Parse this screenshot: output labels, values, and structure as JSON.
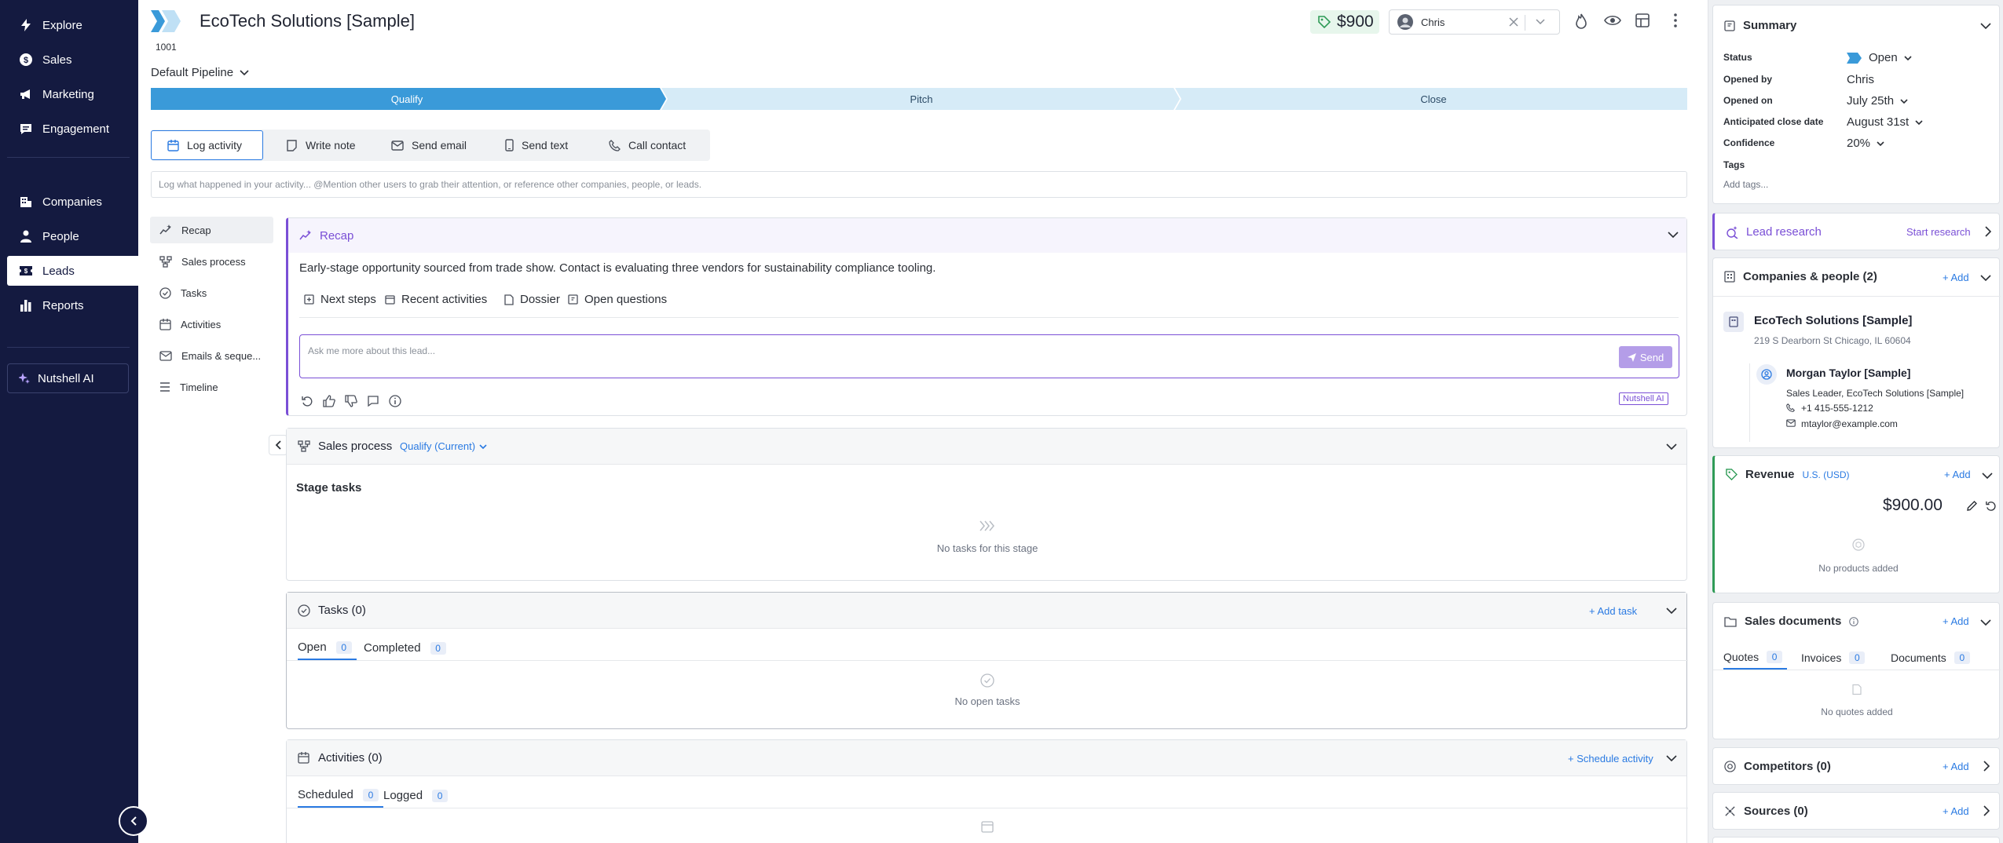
{
  "nav": {
    "items": [
      {
        "label": "Explore",
        "icon": "bolt-icon"
      },
      {
        "label": "Sales",
        "icon": "dollar-icon"
      },
      {
        "label": "Marketing",
        "icon": "megaphone-icon"
      },
      {
        "label": "Engagement",
        "icon": "chat-icon"
      },
      {
        "label": "Companies",
        "icon": "building-icon"
      },
      {
        "label": "People",
        "icon": "person-icon"
      },
      {
        "label": "Leads",
        "icon": "ticket-icon"
      },
      {
        "label": "Reports",
        "icon": "bar-chart-icon"
      }
    ],
    "ai_label": "Nutshell AI"
  },
  "header": {
    "title": "EcoTech Solutions [Sample]",
    "lead_id": "1001",
    "value": "$900",
    "assignee": "Chris",
    "pipeline": "Default Pipeline"
  },
  "stages": [
    "Qualify",
    "Pitch",
    "Close"
  ],
  "actions": [
    "Log activity",
    "Write note",
    "Send email",
    "Send text",
    "Call contact"
  ],
  "log_placeholder": "Log what happened in your activity... @Mention other users to grab their attention, or reference other companies, people, or leads.",
  "sidebar_links": [
    "Recap",
    "Sales process",
    "Tasks",
    "Activities",
    "Emails & seque...",
    "Timeline"
  ],
  "recap": {
    "title": "Recap",
    "text": "Early-stage opportunity sourced from trade show. Contact is evaluating three vendors for sustainability compliance tooling.",
    "chips": [
      "Next steps",
      "Recent activities",
      "Dossier",
      "Open questions"
    ],
    "ask_placeholder": "Ask me more about this lead...",
    "send_label": "Send",
    "badge": "Nutshell AI"
  },
  "sales_process": {
    "title": "Sales process",
    "stage": "Qualify (Current)",
    "stage_tasks": "Stage tasks",
    "empty": "No tasks for this stage"
  },
  "tasks": {
    "title": "Tasks (0)",
    "add": "+ Add task",
    "tabs": [
      {
        "label": "Open",
        "count": "0"
      },
      {
        "label": "Completed",
        "count": "0"
      }
    ],
    "empty": "No open tasks"
  },
  "activities": {
    "title": "Activities (0)",
    "add": "+ Schedule activity",
    "tabs": [
      {
        "label": "Scheduled",
        "count": "0"
      },
      {
        "label": "Logged",
        "count": "0"
      }
    ]
  },
  "summary": {
    "title": "Summary",
    "fields": [
      {
        "label": "Status",
        "value": "Open"
      },
      {
        "label": "Opened by",
        "value": "Chris"
      },
      {
        "label": "Opened on",
        "value": "July 25th"
      },
      {
        "label": "Anticipated close date",
        "value": "August 31st"
      },
      {
        "label": "Confidence",
        "value": "20%"
      }
    ],
    "tags_label": "Tags",
    "tags_placeholder": "Add tags..."
  },
  "lead_research": {
    "title": "Lead research",
    "action": "Start research"
  },
  "companies_people": {
    "title": "Companies & people (2)",
    "add": "+ Add",
    "company": {
      "name": "EcoTech Solutions [Sample]",
      "address": "219 S Dearborn St Chicago, IL 60604"
    },
    "person": {
      "name": "Morgan Taylor [Sample]",
      "role": "Sales Leader, EcoTech Solutions [Sample]",
      "phone": "+1 415-555-1212",
      "email": "mtaylor@example.com"
    }
  },
  "revenue": {
    "title": "Revenue",
    "currency": "U.S. (USD)",
    "add": "+ Add",
    "amount": "$900.00",
    "empty": "No products added"
  },
  "sales_documents": {
    "title": "Sales documents",
    "add": "+ Add",
    "tabs": [
      {
        "label": "Quotes",
        "count": "0"
      },
      {
        "label": "Invoices",
        "count": "0"
      },
      {
        "label": "Documents",
        "count": "0"
      }
    ],
    "empty": "No quotes added"
  },
  "competitors": {
    "title": "Competitors (0)",
    "add": "+ Add"
  },
  "sources": {
    "title": "Sources (0)",
    "add": "+ Add"
  },
  "colors": {
    "nav_bg": "#141a40",
    "accent": "#2a7ae2",
    "stage_active": "#3a9ad9",
    "stage_inactive": "#d6ebf7",
    "ai_purple": "#7a4fd6",
    "value_green": "#e7f6ec"
  }
}
